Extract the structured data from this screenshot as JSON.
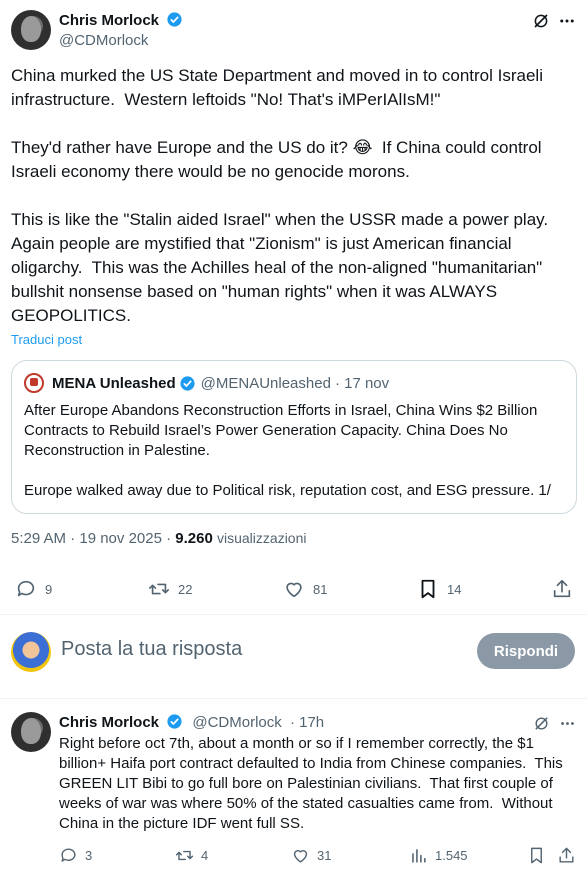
{
  "tweet": {
    "author_name": "Chris Morlock",
    "author_handle": "@CDMorlock",
    "text": "China murked the US State Department and moved in to control Israeli infrastructure.  Western leftoids \"No! That's iMPerIAlIsM!\"\n\nThey'd rather have Europe and the US do it? 😂  If China could control Israeli economy there would be no genocide morons.\n\nThis is like the \"Stalin aided Israel\" when the USSR made a power play.  Again people are mystified that \"Zionism\" is just American financial oligarchy.  This was the Achilles heal of the non-aligned \"humanitarian\" bullshit nonsense based on \"human rights\" when it was ALWAYS GEOPOLITICS.",
    "translate_label": "Traduci post",
    "quote": {
      "name": "MENA Unleashed",
      "handle": "@MENAUnleashed",
      "time": "· 17 nov",
      "text": "After Europe Abandons Reconstruction Efforts in Israel, China Wins $2 Billion Contracts to Rebuild Israel’s Power Generation Capacity. China Does No Reconstruction in Palestine.\n\nEurope walked away due to Political risk, reputation cost, and ESG pressure. 1/"
    },
    "meta": {
      "time": "5:29 AM · 19 nov 2025 ·",
      "views_count": "9.260",
      "views_label": "visualizzazioni"
    },
    "actions": {
      "replies": "9",
      "reposts": "22",
      "likes": "81",
      "bookmarks": "14"
    }
  },
  "compose": {
    "placeholder": "Posta la tua risposta",
    "button_label": "Rispondi"
  },
  "reply": {
    "author_name": "Chris Morlock",
    "author_handle": "@CDMorlock",
    "time": "· 17h",
    "text": "Right before oct 7th, about a month or so if I remember correctly, the $1 billion+ Haifa port contract defaulted to India from Chinese companies.  This GREEN LIT Bibi to go full bore on Palestinian civilians.  That first couple of weeks of war was where 50% of the stated casualties came from.  Without China in the picture IDF went full SS.",
    "actions": {
      "replies": "3",
      "reposts": "4",
      "likes": "31",
      "views": "1.545"
    }
  },
  "icons": [
    "grok-icon",
    "more-icon",
    "verified-badge-icon",
    "reply-icon",
    "repost-icon",
    "like-icon",
    "bookmark-icon",
    "share-icon",
    "views-icon"
  ],
  "colors": {
    "accent": "#1d9bf0",
    "muted": "#536471",
    "button_disabled": "#8b98a5"
  }
}
